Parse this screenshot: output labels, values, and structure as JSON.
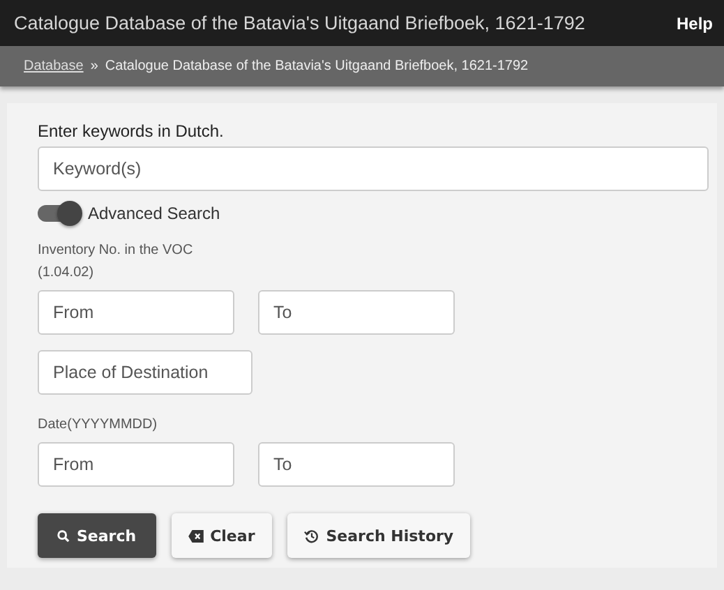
{
  "header": {
    "title": "Catalogue Database of the Batavia's Uitgaand Briefboek, 1621-1792",
    "help": "Help"
  },
  "breadcrumb": {
    "link": "Database",
    "separator": "»",
    "current": "Catalogue Database of the Batavia's Uitgaand Briefboek, 1621-1792"
  },
  "keyword": {
    "label": "Enter keywords in Dutch.",
    "placeholder": "Keyword(s)"
  },
  "advanced": {
    "label": "Advanced Search",
    "on": true
  },
  "inventory": {
    "label_lines": [
      "Inventory No. in the VOC",
      "(1.04.02)"
    ],
    "from": {
      "placeholder": "From"
    },
    "to": {
      "placeholder": "To"
    }
  },
  "destination": {
    "placeholder": "Place of Destination"
  },
  "date": {
    "label": "Date(YYYYMMDD)",
    "from": {
      "placeholder": "From"
    },
    "to": {
      "placeholder": "To"
    }
  },
  "buttons": [
    {
      "kind": "search",
      "label": "Search"
    },
    {
      "kind": "clear",
      "label": "Clear"
    },
    {
      "kind": "history",
      "label": "Search History"
    }
  ]
}
